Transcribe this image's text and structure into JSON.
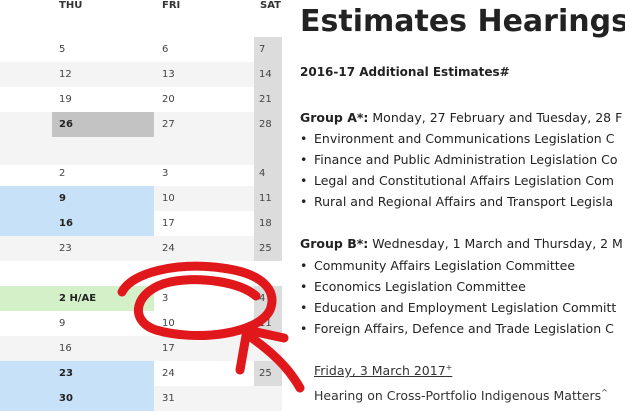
{
  "calendar": {
    "headers": {
      "thu": "THU",
      "fri": "FRI",
      "sat": "SAT"
    },
    "week1": [
      {
        "thu": "5",
        "fri": "6",
        "sat": "7"
      },
      {
        "thu": "12",
        "fri": "13",
        "sat": "14"
      },
      {
        "thu": "19",
        "fri": "20",
        "sat": "21"
      },
      {
        "thu": "26",
        "fri": "27",
        "sat": "28"
      }
    ],
    "week2": [
      {
        "thu": "2",
        "fri": "3",
        "sat": "4"
      },
      {
        "thu": "9",
        "fri": "10",
        "sat": "11"
      },
      {
        "thu": "16",
        "fri": "17",
        "sat": "18"
      },
      {
        "thu": "23",
        "fri": "24",
        "sat": "25"
      }
    ],
    "week3": [
      {
        "thu": "2 H/AE",
        "fri": "3",
        "sat": "4"
      },
      {
        "thu": "9",
        "fri": "10",
        "sat": "11"
      },
      {
        "thu": "16",
        "fri": "17",
        "sat": ""
      },
      {
        "thu": "23",
        "fri": "24",
        "sat": "25"
      },
      {
        "thu": "30",
        "fri": "31",
        "sat": ""
      }
    ]
  },
  "doc": {
    "title": "Estimates Hearings",
    "subtitle": "2016-17 Additional Estimates#",
    "groupA": {
      "label": "Group A*:",
      "dates": " Monday, 27 February and Tuesday, 28 F",
      "items": [
        "Environment and Communications Legislation C",
        "Finance and Public Administration Legislation Co",
        "Legal and Constitutional Affairs Legislation Com",
        "Rural and Regional Affairs and Transport Legisla"
      ]
    },
    "groupB": {
      "label": "Group B*:",
      "dates": " Wednesday, 1 March and Thursday, 2 M",
      "items": [
        "Community Affairs Legislation Committee",
        "Economics Legislation Committee",
        "Education and Employment Legislation Committ",
        "Foreign Affairs, Defence and Trade Legislation C"
      ]
    },
    "friday": "Friday, 3 March 2017",
    "friday_mark": "+",
    "hearing": "Hearing on Cross-Portfolio Indigenous Matters",
    "hearing_mark": "^"
  },
  "colors": {
    "highlight_blue": "#c7e2f8",
    "highlight_gray": "#c3c3c3",
    "highlight_green": "#d3f0c9",
    "annotation_red": "#e0181c"
  }
}
